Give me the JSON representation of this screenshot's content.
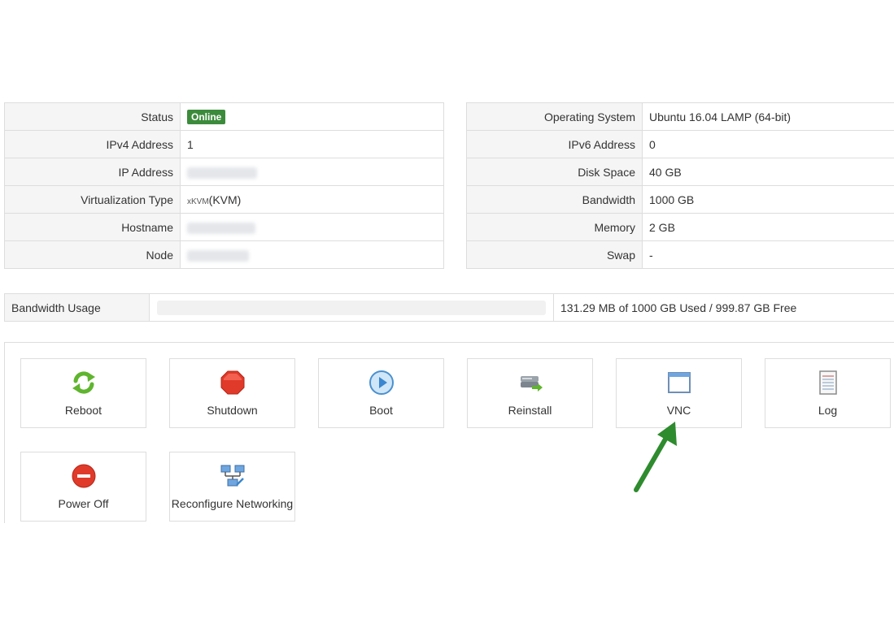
{
  "left_table": {
    "rows": [
      {
        "label": "Status",
        "badge": "Online"
      },
      {
        "label": "IPv4 Address",
        "value": "1"
      },
      {
        "label": "IP Address",
        "value": ""
      },
      {
        "label": "Virtualization Type",
        "prefix": "xKVM",
        "value": "(KVM)"
      },
      {
        "label": "Hostname",
        "value": ""
      },
      {
        "label": "Node",
        "value": ""
      }
    ]
  },
  "right_table": {
    "rows": [
      {
        "label": "Operating System",
        "value": "Ubuntu 16.04 LAMP (64-bit)"
      },
      {
        "label": "IPv6 Address",
        "value": "0"
      },
      {
        "label": "Disk Space",
        "value": "40 GB"
      },
      {
        "label": "Bandwidth",
        "value": "1000 GB"
      },
      {
        "label": "Memory",
        "value": "2 GB"
      },
      {
        "label": "Swap",
        "value": "-"
      }
    ]
  },
  "bandwidth": {
    "label": "Bandwidth Usage",
    "used_fraction": 0.0001,
    "summary": "131.29 MB of 1000 GB Used / 999.87 GB Free"
  },
  "actions": {
    "reboot": "Reboot",
    "shutdown": "Shutdown",
    "boot": "Boot",
    "reinstall": "Reinstall",
    "vnc": "VNC",
    "log": "Log",
    "power_off": "Power Off",
    "reconfigure": "Reconfigure Networking"
  },
  "colors": {
    "online_badge": "#3c8b3c",
    "arrow": "#2e8b2e"
  }
}
